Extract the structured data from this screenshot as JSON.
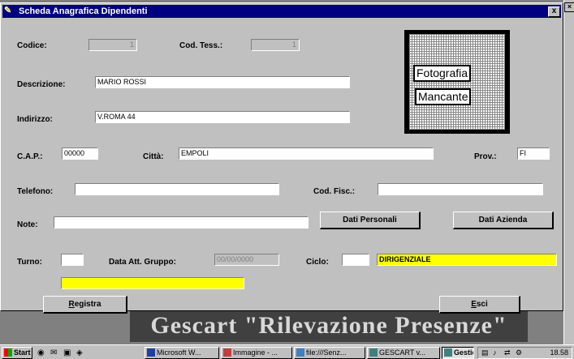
{
  "window": {
    "title": "Scheda Anagrafica Dipendenti",
    "close_label": "x"
  },
  "form": {
    "codice": {
      "label": "Codice:",
      "value": "1"
    },
    "cod_tess": {
      "label": "Cod. Tess.:",
      "value": "1"
    },
    "descrizione": {
      "label": "Descrizione:",
      "value": "MARIO ROSSI"
    },
    "indirizzo": {
      "label": "Indirizzo:",
      "value": "V.ROMA 44"
    },
    "cap": {
      "label": "C.A.P.:",
      "value": "00000"
    },
    "citta": {
      "label": "Città:",
      "value": "EMPOLI"
    },
    "prov": {
      "label": "Prov.:",
      "value": "FI"
    },
    "telefono": {
      "label": "Telefono:",
      "value": ""
    },
    "cod_fisc": {
      "label": "Cod. Fisc.:",
      "value": ""
    },
    "note": {
      "label": "Note:",
      "value": ""
    },
    "turno": {
      "label": "Turno:",
      "value": ""
    },
    "data_att_gruppo": {
      "label": "Data Att. Gruppo:",
      "value": "00/00/0000"
    },
    "ciclo": {
      "label": "Ciclo:",
      "value": "",
      "description": "DIRIGENZIALE"
    },
    "turno_description": ""
  },
  "photo": {
    "line1": "Fotografia",
    "line2": "Mancante"
  },
  "buttons": {
    "dati_personali": "Dati Personali",
    "dati_azienda": "Dati Azienda",
    "registra": "Registra",
    "esci": "Esci"
  },
  "background": {
    "banner": "Gescart \"Rilevazione Presenze\""
  },
  "taskbar": {
    "start": "Start",
    "tasks": [
      "Microsoft W...",
      "Immagine - ...",
      "file:///Senz...",
      "GESCART v...",
      "Gestione"
    ],
    "clock": "18.58"
  },
  "colors": {
    "titlebar": "#000080",
    "highlight_field": "#ffff00",
    "dialog": "#c0c0c0"
  }
}
